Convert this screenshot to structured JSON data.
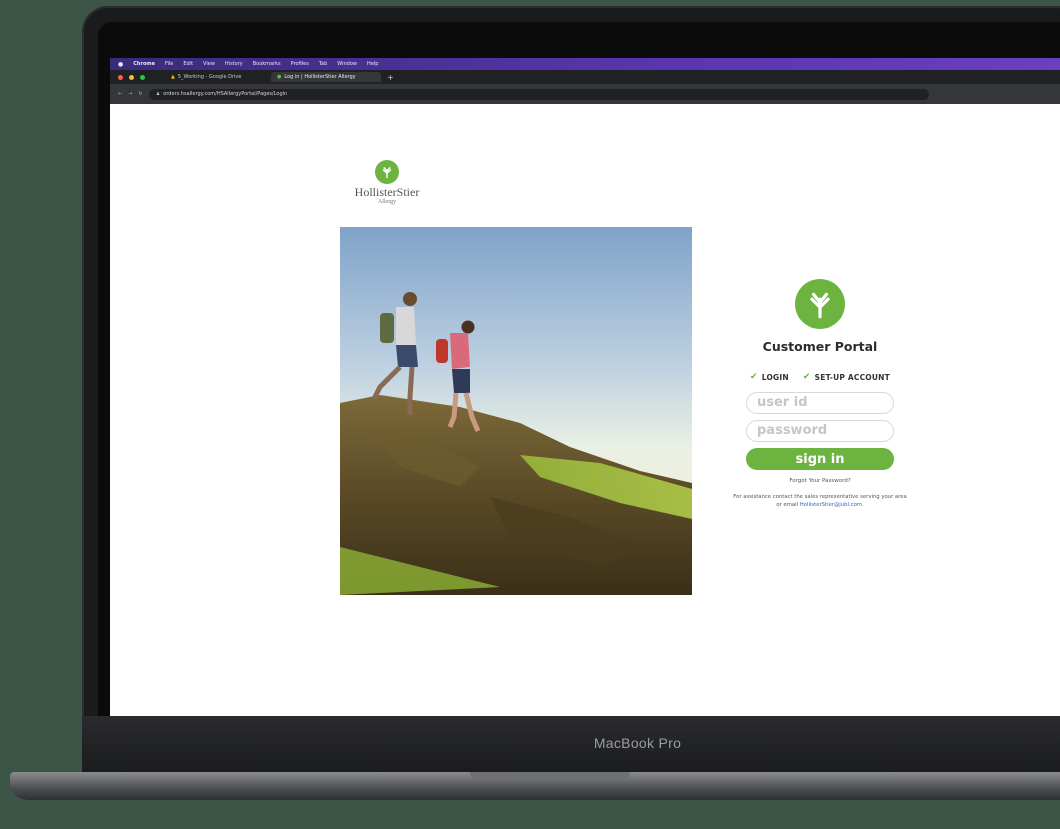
{
  "device": {
    "label": "MacBook Pro"
  },
  "browser": {
    "menu": [
      "Chrome",
      "File",
      "Edit",
      "View",
      "History",
      "Bookmarks",
      "Profiles",
      "Tab",
      "Window",
      "Help"
    ],
    "tabs": [
      {
        "label": "5_Working - Google Drive"
      },
      {
        "label": "Log in | HollisterStier Allergy"
      }
    ],
    "url": "orders.hsallergy.com/HSAllergyPortal/Pages/Login"
  },
  "brand": {
    "name": "HollisterStier",
    "sub": "Allergy"
  },
  "portal": {
    "title": "Customer Portal",
    "tabs": [
      "LOGIN",
      "SET-UP ACCOUNT"
    ],
    "user_placeholder": "user id",
    "password_placeholder": "password",
    "signin_label": "sign in",
    "forgot": "Forgot Your Password?",
    "assist_line1": "For assistance contact the sales representative serving your area",
    "assist_line2_prefix": "or email",
    "assist_email": "HollisterStier@jubl.com."
  },
  "colors": {
    "accent": "#6db33f",
    "link": "#2a6cc0"
  }
}
